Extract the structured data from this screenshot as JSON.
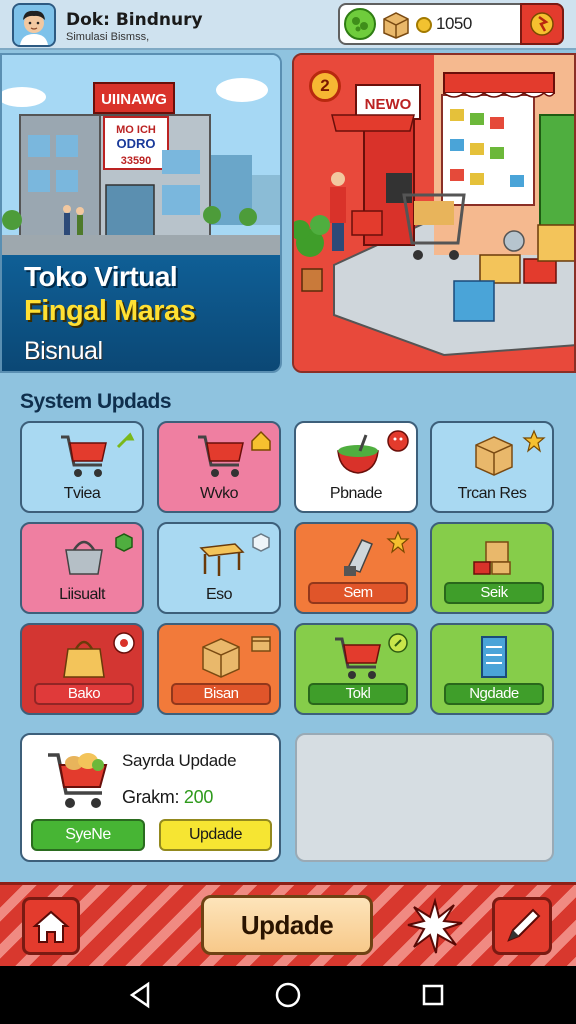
{
  "header": {
    "title": "Dok: Bindnury",
    "subtitle": "Simulasi Bismss,",
    "resources": {
      "gem_icon": "gem-icon",
      "crate_icon": "crate-icon",
      "coin_icon": "coin-icon",
      "coin_value": "1050"
    }
  },
  "hero": {
    "title": "Toko Virtual",
    "subtitle": "Fingal Maras",
    "tag": "Bisnual",
    "store_sign": "UIINAWG",
    "building_sign_lines": [
      "MO ICH",
      "ODRO",
      "33590"
    ],
    "badge_number": "2",
    "shop_sign": "NEWO"
  },
  "section": {
    "title": "System Updads"
  },
  "tiles": [
    {
      "label": "Tviea",
      "icon": "cart-icon",
      "badge": "wrench-icon",
      "style": "plain",
      "bg": "#a9d9f2"
    },
    {
      "label": "Wvko",
      "icon": "cart-icon",
      "badge": "home-badge-icon",
      "style": "plain",
      "bg": "#ef7fa1"
    },
    {
      "label": "Pbnade",
      "icon": "bowl-icon",
      "badge": "alert-icon",
      "style": "plain",
      "bg": "#ffffff"
    },
    {
      "label": "Trcan Res",
      "icon": "box-icon",
      "badge": "star-icon",
      "style": "plain",
      "bg": "#a9d9f2"
    },
    {
      "label": "Liisualt",
      "icon": "basket-icon",
      "badge": "cube-icon",
      "style": "plain",
      "bg": "#ef7fa1"
    },
    {
      "label": "Eso",
      "icon": "table-icon",
      "badge": "cube-outline-icon",
      "style": "plain",
      "bg": "#a9d9f2"
    },
    {
      "label": "Sem",
      "icon": "scanner-icon",
      "badge": "star-icon",
      "style": "button",
      "bg": "#f27a3a",
      "btn": "#e0552a"
    },
    {
      "label": "Seik",
      "icon": "boxes-icon",
      "badge": "",
      "style": "button",
      "bg": "#86cd4a",
      "btn": "#3f9e2a"
    },
    {
      "label": "Bako",
      "icon": "bag-icon",
      "badge": "record-icon",
      "style": "button",
      "bg": "#d33632",
      "btn": "#e03a3a"
    },
    {
      "label": "Bisan",
      "icon": "box-icon",
      "badge": "box-small-icon",
      "style": "button",
      "bg": "#f27a3a",
      "btn": "#e0552a"
    },
    {
      "label": "Tokl",
      "icon": "cart-icon",
      "badge": "search-icon",
      "style": "button",
      "bg": "#86cd4a",
      "btn": "#3f9e2a"
    },
    {
      "label": "Ngdade",
      "icon": "server-icon",
      "badge": "",
      "style": "button",
      "bg": "#86cd4a",
      "btn": "#3f9e2a"
    }
  ],
  "update_card": {
    "title": "Sayrda Updade",
    "progress_label": "Grakm:",
    "progress_value": "200",
    "primary_button": "SyeNe",
    "secondary_button": "Updade"
  },
  "bottom_nav": {
    "home_icon": "home-icon",
    "update_button": "Updade",
    "splat_icon": "splat-icon",
    "edit_icon": "pencil-icon"
  },
  "system_nav": [
    "back-icon",
    "home-circle-icon",
    "recents-icon"
  ]
}
